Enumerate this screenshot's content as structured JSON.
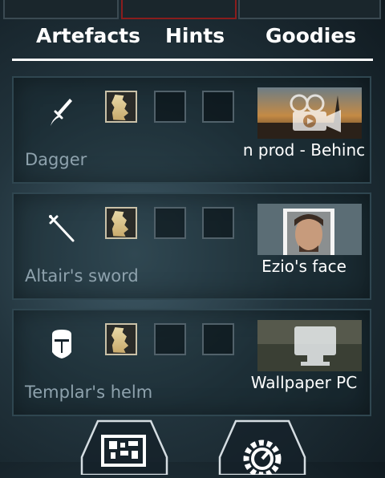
{
  "tabs": [
    {
      "label": "Artefacts",
      "active": true
    },
    {
      "label": "Hints",
      "active": false
    },
    {
      "label": "Goodies",
      "active": false
    }
  ],
  "items": [
    {
      "name": "Dagger",
      "icon": "dagger-icon",
      "slots_filled": 1,
      "slots_total": 3,
      "unlock_label": "n prod - Behinc",
      "unlock_icon": "video-camera-icon"
    },
    {
      "name": "Altair's sword",
      "icon": "sword-icon",
      "slots_filled": 1,
      "slots_total": 3,
      "unlock_label": "Ezio's face",
      "unlock_icon": "portrait-icon"
    },
    {
      "name": "Templar's helm",
      "icon": "helm-icon",
      "slots_filled": 1,
      "slots_total": 3,
      "unlock_label": "Wallpaper PC",
      "unlock_icon": "monitor-icon"
    }
  ],
  "bottom_buttons": [
    {
      "icon": "qr-code-icon"
    },
    {
      "icon": "gear-icon"
    }
  ],
  "colors": {
    "active_tab_border": "#8a1d1d",
    "underline": "#ffffff",
    "item_label": "#8ea2ad"
  }
}
